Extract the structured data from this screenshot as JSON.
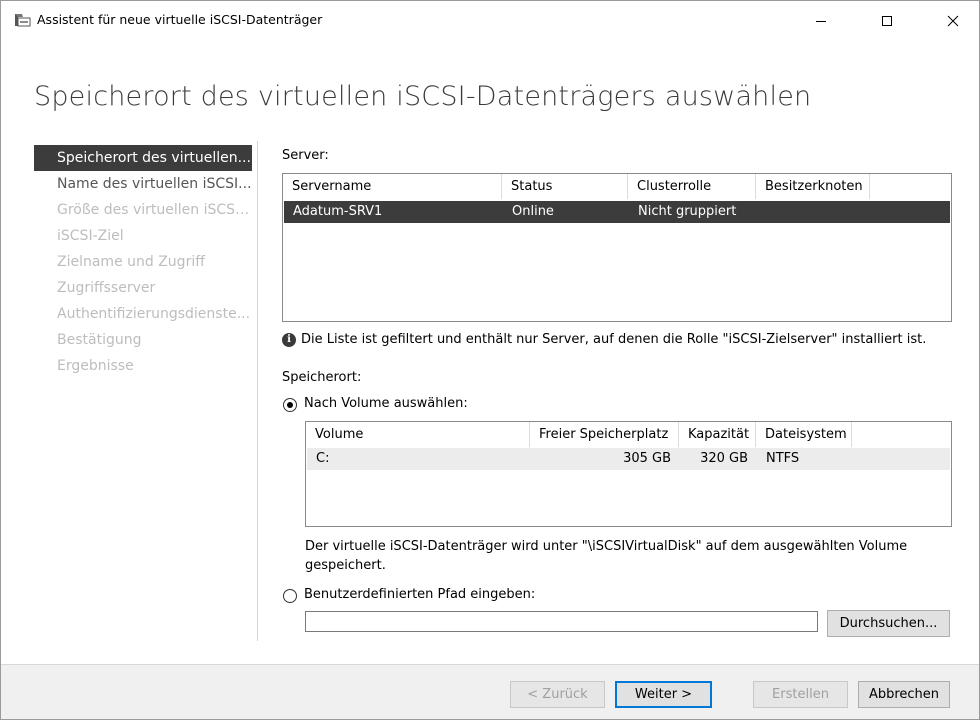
{
  "window": {
    "title": "Assistent für neue virtuelle iSCSI-Datenträger",
    "controls": {
      "minimize": "minimize-icon",
      "maximize": "maximize-icon",
      "close": "close-icon"
    }
  },
  "page": {
    "title": "Speicherort des virtuellen iSCSI-Datenträgers auswählen"
  },
  "nav": {
    "items": [
      {
        "label": "Speicherort des virtuellen...",
        "state": "active"
      },
      {
        "label": "Name des virtuellen iSCSI...",
        "state": "enabled"
      },
      {
        "label": "Größe des virtuellen iSCSI...",
        "state": "disabled"
      },
      {
        "label": "iSCSI-Ziel",
        "state": "disabled"
      },
      {
        "label": "Zielname und Zugriff",
        "state": "disabled"
      },
      {
        "label": "Zugriffsserver",
        "state": "disabled"
      },
      {
        "label": "Authentifizierungsdienste...",
        "state": "disabled"
      },
      {
        "label": "Bestätigung",
        "state": "disabled"
      },
      {
        "label": "Ergebnisse",
        "state": "disabled"
      }
    ]
  },
  "server": {
    "label": "Server:",
    "columns": [
      "Servername",
      "Status",
      "Clusterrolle",
      "Besitzerknoten"
    ],
    "rows": [
      {
        "Servername": "Adatum-SRV1",
        "Status": "Online",
        "Clusterrolle": "Nicht gruppiert",
        "Besitzerknoten": ""
      }
    ],
    "info": "Die Liste ist gefiltert und enthält nur Server, auf denen die Rolle \"iSCSI-Zielserver\" installiert ist."
  },
  "storage": {
    "label": "Speicherort:",
    "option_volume": "Nach Volume auswählen:",
    "volume_columns": [
      "Volume",
      "Freier Speicherplatz",
      "Kapazität",
      "Dateisystem"
    ],
    "volume_rows": [
      {
        "Volume": "C:",
        "free": "305 GB",
        "capacity": "320 GB",
        "fs": "NTFS"
      }
    ],
    "note_line1": "Der virtuelle iSCSI-Datenträger wird unter \"\\iSCSIVirtualDisk\" auf dem ausgewählten Volume",
    "note_line2": "gespeichert.",
    "option_custom": "Benutzerdefinierten Pfad eingeben:",
    "custom_path_value": "",
    "browse_label": "Durchsuchen..."
  },
  "footer": {
    "back": "< Zurück",
    "next": "Weiter >",
    "create": "Erstellen",
    "cancel": "Abbrechen"
  }
}
